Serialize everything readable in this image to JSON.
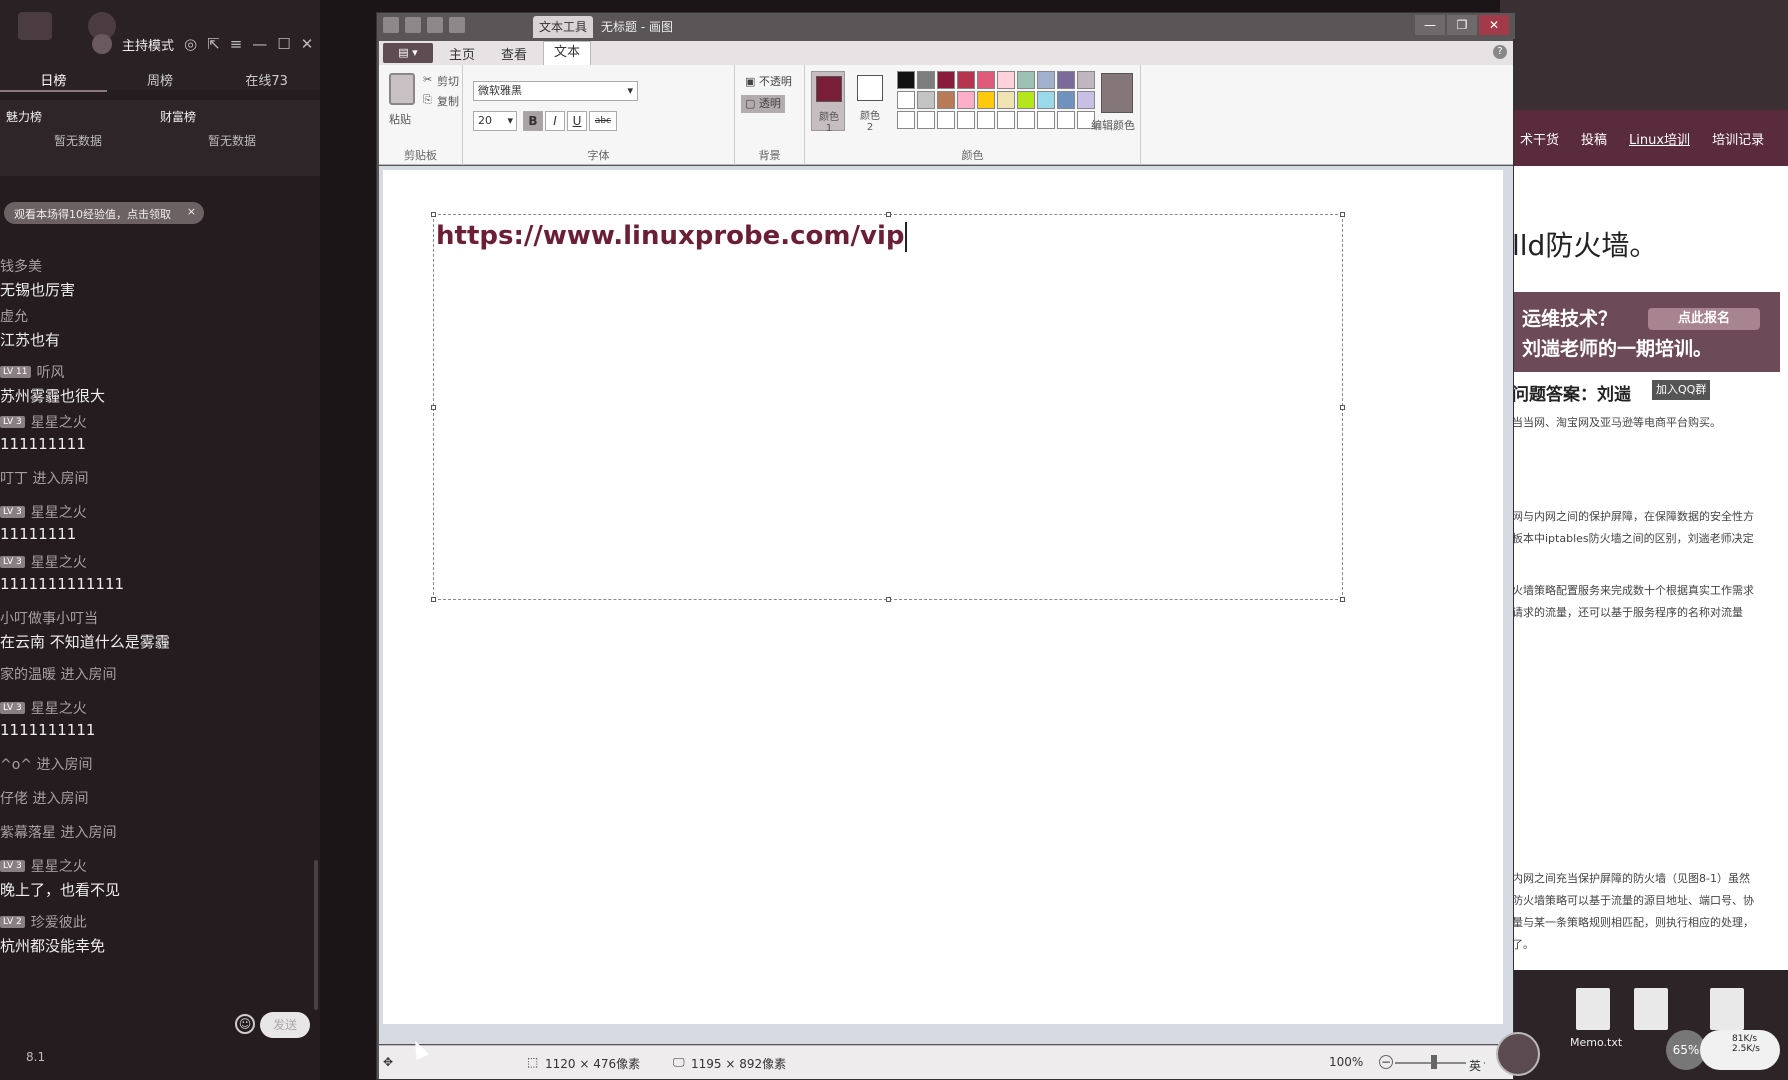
{
  "live": {
    "host_mode": "主持模式",
    "tabs": [
      "日榜",
      "周榜",
      "在线73"
    ],
    "ranks": {
      "left_title": "魅力榜",
      "right_title": "财富榜",
      "left_empty": "暂无数据",
      "right_empty": "暂无数据"
    },
    "toast": "观看本场得10经验值，点击领取",
    "messages": [
      {
        "user": "钱多美",
        "lv": "",
        "text": "无锡也厉害"
      },
      {
        "user": "虚允",
        "lv": "",
        "text": "江苏也有"
      },
      {
        "user": "听风",
        "lv": "LV 11",
        "text": "苏州雾霾也很大"
      },
      {
        "user": "星星之火",
        "lv": "LV 3",
        "text": "111111111"
      },
      {
        "sys": "叮丁 进入房间"
      },
      {
        "user": "星星之火",
        "lv": "LV 3",
        "text": "11111111"
      },
      {
        "user": "星星之火",
        "lv": "LV 3",
        "text": "1111111111111"
      },
      {
        "user": "小叮做事小叮当",
        "lv": "",
        "text": "在云南 不知道什么是雾霾"
      },
      {
        "sys": "家的温暖 进入房间"
      },
      {
        "user": "星星之火",
        "lv": "LV 3",
        "text": "1111111111"
      },
      {
        "sys": "^o^ 进入房间"
      },
      {
        "sys": "仔佬 进入房间"
      },
      {
        "sys": "紫幕落星 进入房间"
      },
      {
        "user": "星星之火",
        "lv": "LV 3",
        "text": "晚上了，也看不见"
      },
      {
        "user": "珍爱彼此",
        "lv": "LV 2",
        "text": "杭州都没能幸免"
      }
    ],
    "send_label": "发送",
    "version": "8.1"
  },
  "paint": {
    "title_tab": "文本工具",
    "window_title": "无标题 - 画图",
    "ribbon_tabs": [
      "主页",
      "查看",
      "文本"
    ],
    "clipboard": {
      "paste": "粘贴",
      "cut": "剪切",
      "copy": "复制",
      "label": "剪贴板"
    },
    "font": {
      "family": "微软雅黑",
      "size": "20",
      "bold": "B",
      "italic": "I",
      "underline": "U",
      "strike": "abc",
      "label": "字体"
    },
    "background": {
      "opaque": "不透明",
      "transparent": "透明",
      "label": "背景"
    },
    "colors": {
      "color1": "颜色 1",
      "color2": "颜色 2",
      "edit": "编辑颜色",
      "label": "颜色",
      "color1_hex": "#7a1e37",
      "color2_hex": "#ffffff"
    },
    "canvas_text": "https://www.linuxprobe.com/vip",
    "status": {
      "selection": "1120 × 476像素",
      "canvas": "1195 × 892像素",
      "zoom": "100%"
    }
  },
  "web": {
    "nav": [
      "术干货",
      "投稿",
      "Linux培训",
      "培训记录"
    ],
    "headline": "lld防火墙。",
    "banner_l1": "运维技术？",
    "banner_btn": "点此报名",
    "banner_l2": "刘遄老师的一期培训。",
    "qa": "问题答案：刘遄",
    "qq": "加入QQ群",
    "p1": "当当网、淘宝网及亚马逊等电商平台购买。",
    "p2": "网与内网之间的保护屏障，在保障数据的安全性方",
    "p3": "板本中iptables防火墙之间的区别，刘遄老师决定",
    "p4": "火墙策略配置服务来完成数十个根据真实工作需求",
    "p5": "请求的流量，还可以基于服务程序的名称对流量",
    "p6": "内网之间充当保护屏障的防火墙（见图8-1）虽然",
    "p7": "防火墙策略可以基于流量的源目地址、端口号、协",
    "p8": "量与某一条策略规则相匹配，则执行相应的处理，",
    "p9": "了。",
    "memo": "Memo.txt",
    "cpu": "65%",
    "net_up": "81K/s",
    "net_down": "2.5K/s",
    "ime": "英"
  }
}
